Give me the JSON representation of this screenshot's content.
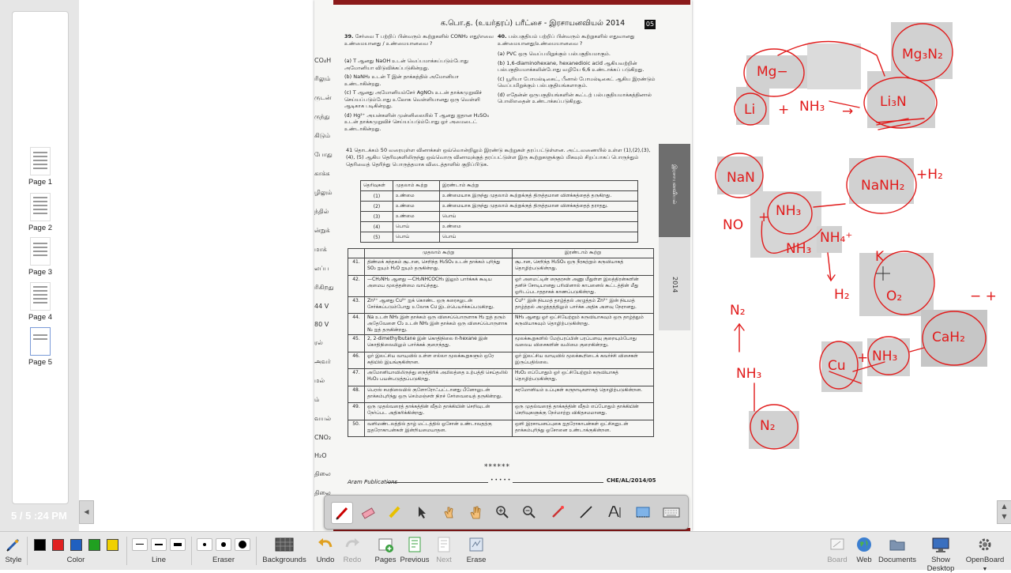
{
  "sidebar": {
    "pages": [
      {
        "label": "Page 1"
      },
      {
        "label": "Page 2"
      },
      {
        "label": "Page 3"
      },
      {
        "label": "Page 4"
      },
      {
        "label": "Page 5"
      }
    ],
    "status": "5 / 5 :24 PM"
  },
  "document": {
    "header": "க.பொ.த. (உயர்தரப்) பரீட்சை - இரசாயனவியல் 2014",
    "page_number": "05",
    "side_marks": [
      "CO₄H",
      "ரிலும்",
      "ருடன்",
      "ருந்து",
      "கிடும்",
      "போது",
      "காக்க",
      "ழிலும்",
      "ந்தில்",
      "ன்றுக்",
      "மாக்",
      "லப்ப",
      "ரிகிறது",
      "44 V",
      "80 V",
      "ரல்",
      "அவர்",
      "மல்",
      "ம்",
      "வயல்",
      "CNO₂",
      "H₂O",
      "திலை",
      "திலை"
    ],
    "q39_num": "39.",
    "q39_text": "சேர்வை T பற்றிப் பின்வரும் கூற்றுகளில் CONH₂ எது/எவை உண்மையானது / உண்மையானவை ?",
    "q39_options": [
      "(a) T ஆனது NaOH உடன் வெப்பமாக்கப்படும்போது அமோனியா விடுவிக்கப்படுகின்றது.",
      "(b) NaNH₂ உடன் T இன் தாக்கத்தில் அமோனியா உண்டாகின்றது.",
      "(c) T ஆனது அமோனியம்சேர் AgNO₃ உடன் தாக்கமுறுவிச் செய்யப்படும்போது உலோக வெள்ளியானது ஒரு வெள்ளி ஆடிகாக படிகின்றது.",
      "(d) Hg²⁺ அயன்களின் முன்னிலையில் T ஆனது ஐதான H₂SO₄ உடன் தாக்கமுறுவிச் செய்யப்படும்போது ஓர் அமைடைட் உண்டாகின்றது."
    ],
    "q40_num": "40.",
    "q40_text": "பல்பகுதியம் பற்றிப் பின்வரும் கூற்றுகளில் எதுவானது உண்மையானது/உண்மையானவை ?",
    "q40_options": [
      "(a) PVC ஒரு வெப்பமிறுக்கும் பல்பகுதியமாகும்.",
      "(b) 1,6-diaminohexane, hexanedioic acid ஆகியவற்றின் பல்பகுதியமாக்கலின்போது வழியே 6,6 உண்டாக்கப் படுகிறது.",
      "(c) யூரியா போமல்டிகைட், பீனால் போமல்டிகைட் ஆகிய இரண்டும் வெப்பமிறுக்கும் பல்பகுதியங்களாகும்.",
      "(d) எதேன்ன் ஒருபகுதியங்களின் கூட்டற் பல்பகுதியமாக்கத்தினால் பொலிஎதைன் உண்டாக்கப்படுகிறது."
    ],
    "q41_intro": "41 தொடக்கம் 50 வரையுள்ள வினாக்கள் ஒவ்வொன்றிலும் இரண்டு கூற்றுகள் தரப்பட்டுள்ளன. அட்டவணையில் உள்ள (1),(2),(3),(4), (5) ஆகிய தெரிவுகளிலிருந்து ஒவ்வொரு வினாவுக்குத் தரப்பட்டுள்ள இரு கூற்றுகளுக்கும் மிகவும் சிறப்பாகப் பொருந்தும் தெரிவைத் தெரிந்து பொருத்தமாக விடைத்தாளில் குறிப்பிடுக.",
    "option_table": {
      "headers": [
        "தெரிவுகள்",
        "முதலாம் கூற்று",
        "இரண்டாம் கூற்று"
      ],
      "rows": [
        [
          "(1)",
          "உண்மை",
          "உண்மையாக இருந்து முதலாம் கூற்றுக்குத் திருத்தமான விளக்கத்தைத் தருகிறது."
        ],
        [
          "(2)",
          "உண்மை",
          "உண்மையாக இருந்து முதலாம் கூற்றுக்குத் திருத்தமான விளக்கத்தைத் தராதது."
        ],
        [
          "(3)",
          "உண்மை",
          "பொய்"
        ],
        [
          "(4)",
          "பொய்",
          "உண்மை"
        ],
        [
          "(5)",
          "பொய்",
          "பொய்"
        ]
      ]
    },
    "statement_table": {
      "headers": [
        "முதலாம் கூற்று",
        "இரண்டாம் கூற்று"
      ],
      "rows": [
        [
          "41.",
          "திண்மக் கந்தகம் சூடான, செறிந்த H₂SO₄ உடன் தாக்கம் புரிந்து SO₂ ஐயும் H₂O ஐயும் தருகின்றது.",
          "சூடான, செறிந்த H₂SO₄ ஒரு நீரகற்றும் கருவியாகத் தொழிற்படுகின்றது."
        ],
        [
          "42.",
          "—CH₂NH₂ ஆனது —CH₂NHCOCH₃ இலும் பார்க்கக் கூடிய அமைய மூலத்தன்மை வாய்ந்தது.",
          "ஓர் அமைட்டின் நைதரசன் அணு மீதுள்ள இலத்திரன்களின் தனிச் சோடியானது பரிவினால் காபனைல் கூட்டத்தின் மீது ஓரிடப்படாததாகக் காணப்படுகின்றது."
        ],
        [
          "43.",
          "Zn²⁺ ஆனது Cu²⁺ ஐக் கொண்ட ஒரு கரைசலுடன் சேர்க்கப்படும்போது உலோக Cu இடம்பெயர்க்கப்படுகிறது.",
          "Cu²⁺ இன் நியமத் தாழ்த்தல் அழுத்தம் Zn²⁺ இன் நியமத் தாழ்த்தல் அழுத்தத்திலும் பார்க்க அதிக அளவு நேரானது."
        ],
        [
          "44.",
          "Na உடன் NH₃ இன் தாக்கம் ஒரு விசைப்பொருளாக H₂ ஐத் தரும் அதேவேளை Cl₂ உடன் NH₃ இன் தாக்கம் ஒரு விசைப்பொருளாக N₂ ஐத் தருகின்றது.",
          "NH₃ ஆனது ஓர் ஒட்சியேற்றும் கருவியாகவும் ஒரு தாழ்த்தும் கருவியாகவும் தொழிற்படுகின்றது."
        ],
        [
          "45.",
          "2, 2-dimethylbutane இன் கொதிநிலை n-hexane இன் கொதிநிலையிலும் பார்க்கக் குறைந்தது.",
          "மூலக்கூறுகளில் மேற்பரப்பின் பரப்பளவு குறையும்போது வலைய விசைகளின் வலிமை குறைகின்றது."
        ],
        [
          "46.",
          "ஓர் இலட்சிய வாயுவில் உள்ள எல்லா மூலக்கூறுகளும் ஒரே கதியில் இயங்குகின்றன.",
          "ஓர் இலட்சிய வாயுவில் மூலக்கூறிடைக் கவர்ச்சி விசைகள் இருப்பதில்லை."
        ],
        [
          "47.",
          "அமோனியாவிலிருந்து நைத்திரிக் அமிலத்தை உற்பத்தி செய்தலில் H₂O₂ பயன்படுத்தப்படுகிறது.",
          "H₂O₂ எப்போதும் ஓர் ஒட்சியேற்றும் கருவியாகத் தொழிற்படுகின்றது."
        ],
        [
          "48.",
          "பெரஸ் சமநிலையில் குளோரோஃபட்டானது பீனோலுடன் தாக்கம்புரிந்து ஒரு செம்மஞ்சள் நிறச் சேர்வையைத் தருகின்றது.",
          "கரமோனியம் உப்புகள் கருநாடிகளாகத் தொழிற்படுகின்றன."
        ],
        [
          "49.",
          "ஒரு முதல்வரைத் தாக்கத்தின் வீதம் தாக்கியின் செறிவுடன் நேர்ப்பட அதிகரிக்கின்றது.",
          "ஒரு முதல்வரைத் தாக்கத்தின் வீதம் எப்போதும் தாக்கியின் செறிவுகளுக்கு நேர்மாற்று விகிதசமமானது."
        ],
        [
          "50.",
          "வளிமண்டலத்தில் தாழ் மட்டத்தில் ஓசோன் உண்டாவதற்கு ஐதரோகாபன்கள் இன்றியமையாதன.",
          "ஒளி இரசாயனப்புகை ஐதரோகாபன்கள் ஒட்சிசனுடன் தாக்கம்புரிந்து ஓசோனை உண்டாக்குகின்றன."
        ]
      ]
    },
    "side_vertical_label": "இரசாயனவியல்",
    "side_year": "2014",
    "stars": "******",
    "footer_left": "Aram Publications",
    "footer_mid": "• • • • •",
    "footer_right": "CHE/AL/2014/05"
  },
  "floating_toolbar": {
    "tools": [
      "pen-icon",
      "eraser-icon",
      "highlighter-icon",
      "pointer-icon",
      "select-hand-icon",
      "pan-hand-icon",
      "zoom-in-icon",
      "zoom-out-icon",
      "laser-pen-icon",
      "line-icon",
      "text-tool-icon",
      "screen-capture-icon",
      "keyboard-icon"
    ]
  },
  "toolbar": {
    "style_label": "Style",
    "color_label": "Color",
    "line_label": "Line",
    "eraser_label": "Eraser",
    "backgrounds_label": "Backgrounds",
    "undo_label": "Undo",
    "redo_label": "Redo",
    "pages_label": "Pages",
    "previous_label": "Previous",
    "next_label": "Next",
    "erase_label": "Erase",
    "board_label": "Board",
    "web_label": "Web",
    "documents_label": "Documents",
    "show_desktop_label": "Show Desktop",
    "openboard_label": "OpenBoard",
    "colors": [
      "#000000",
      "#e02020",
      "#2060c0",
      "#20a020",
      "#f0d000"
    ]
  },
  "annotations": {
    "ink_color": "#e11b1b",
    "shade_color": "#c4c4c4",
    "labels": [
      "Mg₃N₂",
      "Mg−",
      "Li",
      "+",
      "NH₃",
      "→",
      "Li₃N",
      "NaN",
      "NaNH₂",
      "+H₂",
      "NO",
      "+",
      "NH₃",
      "NH₃",
      "NH₄⁺",
      "H₂",
      "K",
      "O₂",
      "N₂",
      "NH₃",
      "N₂",
      "CaH₂",
      "Cu",
      "+",
      "NH₃",
      "− +"
    ]
  }
}
